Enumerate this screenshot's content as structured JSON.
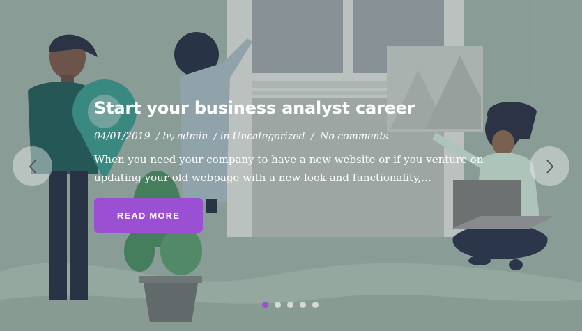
{
  "slide": {
    "title": "Start your business analyst career",
    "meta": {
      "date": "04/01/2019",
      "author_prefix": "/ by",
      "author": "admin",
      "category_prefix": "/ in",
      "category": "Uncategorized",
      "comments_prefix": "/",
      "comments": "No comments"
    },
    "excerpt": "When you need your company to have a new website or if you venture on updating your old webpage with a new look and functionality,...",
    "button_label": "READ MORE"
  },
  "navigation": {
    "prev_icon": "chevron-left-icon",
    "next_icon": "chevron-right-icon"
  },
  "pagination": {
    "count": 5,
    "active_index": 0
  },
  "colors": {
    "accent": "#9b4fd3",
    "background": "#8fa39c",
    "text": "#ffffff"
  }
}
